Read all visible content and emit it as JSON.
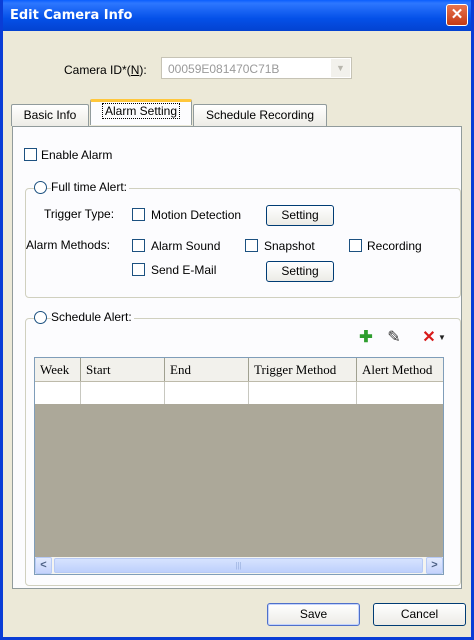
{
  "window": {
    "title": "Edit Camera Info",
    "close_glyph": "✕"
  },
  "camera": {
    "label": "Camera ID*(N):",
    "label_prefix": "Camera ID*(",
    "label_accel": "N",
    "label_suffix": "):",
    "value": "00059E081470C71B"
  },
  "tabs": [
    {
      "label": "Basic Info",
      "active": false
    },
    {
      "label": "Alarm Setting",
      "active": true
    },
    {
      "label": "Schedule Recording",
      "active": false
    }
  ],
  "alarm": {
    "enable_label": "Enable Alarm",
    "full_time": {
      "label": "Full time Alert:",
      "trigger_type_label": "Trigger Type:",
      "motion_label": "Motion Detection",
      "setting1": "Setting",
      "methods_label": "Alarm Methods:",
      "sound_label": "Alarm Sound",
      "snapshot_label": "Snapshot",
      "recording_label": "Recording",
      "email_label": "Send E-Mail",
      "setting2": "Setting"
    },
    "schedule": {
      "label": "Schedule Alert:",
      "columns": [
        "Week",
        "Start",
        "End",
        "Trigger Method",
        "Alert Method"
      ]
    }
  },
  "icons": {
    "add": "add-icon",
    "edit": "edit-icon",
    "delete": "delete-icon",
    "dropdown": "dropdown-arrow-icon"
  },
  "colors": {
    "title_bar": "#0A5EFE",
    "window_bg": "#ECE9D8",
    "grid_bg": "#ACA899",
    "add_green": "#2E9E2E",
    "delete_red": "#D81A1A"
  },
  "footer": {
    "save": "Save",
    "cancel": "Cancel"
  }
}
